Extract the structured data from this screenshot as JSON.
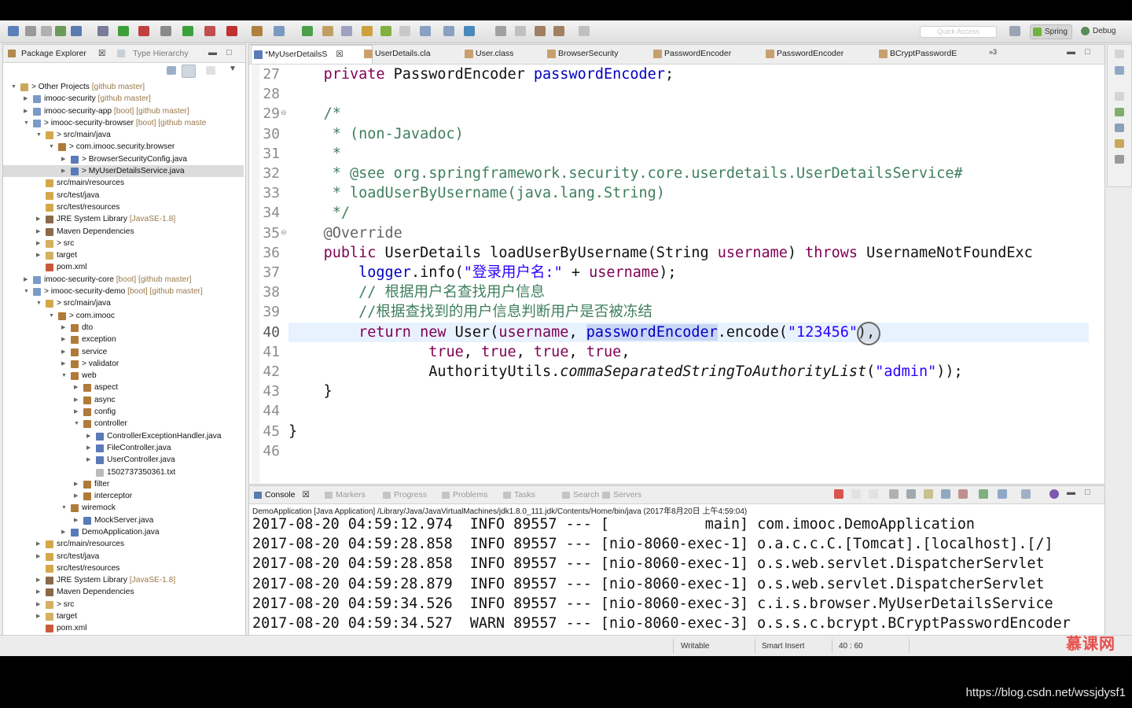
{
  "toolbar": {
    "quick_access_placeholder": "Quick Access",
    "perspectives": [
      {
        "label": "Spring",
        "active": true
      },
      {
        "label": "Debug",
        "active": false
      }
    ]
  },
  "explorer": {
    "tabs": [
      {
        "label": "Package Explorer",
        "active": true
      },
      {
        "label": "Type Hierarchy",
        "active": false
      }
    ],
    "tree": [
      {
        "label": "> Other Projects",
        "decor": "[github master]",
        "indent": 0,
        "arrow": "▼",
        "icon": "project-folder",
        "selected": false
      },
      {
        "label": "imooc-security",
        "decor": "[github master]",
        "indent": 1,
        "arrow": "▶",
        "icon": "project",
        "selected": false
      },
      {
        "label": "imooc-security-app",
        "decor": "[boot] [github master]",
        "indent": 1,
        "arrow": "▶",
        "icon": "project",
        "selected": false
      },
      {
        "label": "> imooc-security-browser",
        "decor": "[boot] [github maste",
        "indent": 1,
        "arrow": "▼",
        "icon": "project",
        "selected": false
      },
      {
        "label": "> src/main/java",
        "decor": "",
        "indent": 2,
        "arrow": "▼",
        "icon": "source-folder",
        "selected": false
      },
      {
        "label": "> com.imooc.security.browser",
        "decor": "",
        "indent": 3,
        "arrow": "▼",
        "icon": "package",
        "selected": false
      },
      {
        "label": "> BrowserSecurityConfig.java",
        "decor": "",
        "indent": 4,
        "arrow": "▶",
        "icon": "java-file",
        "selected": false
      },
      {
        "label": "> MyUserDetailsService.java",
        "decor": "",
        "indent": 4,
        "arrow": "▶",
        "icon": "java-file",
        "selected": true
      },
      {
        "label": "src/main/resources",
        "decor": "",
        "indent": 2,
        "arrow": "",
        "icon": "source-folder",
        "selected": false
      },
      {
        "label": "src/test/java",
        "decor": "",
        "indent": 2,
        "arrow": "",
        "icon": "source-folder",
        "selected": false
      },
      {
        "label": "src/test/resources",
        "decor": "",
        "indent": 2,
        "arrow": "",
        "icon": "source-folder",
        "selected": false
      },
      {
        "label": "JRE System Library",
        "decor": "[JavaSE-1.8]",
        "indent": 2,
        "arrow": "▶",
        "icon": "library",
        "selected": false
      },
      {
        "label": "Maven Dependencies",
        "decor": "",
        "indent": 2,
        "arrow": "▶",
        "icon": "library",
        "selected": false
      },
      {
        "label": "> src",
        "decor": "",
        "indent": 2,
        "arrow": "▶",
        "icon": "folder",
        "selected": false
      },
      {
        "label": "target",
        "decor": "",
        "indent": 2,
        "arrow": "▶",
        "icon": "folder",
        "selected": false
      },
      {
        "label": "pom.xml",
        "decor": "",
        "indent": 2,
        "arrow": "",
        "icon": "xml-file",
        "selected": false
      },
      {
        "label": "imooc-security-core",
        "decor": "[boot] [github master]",
        "indent": 1,
        "arrow": "▶",
        "icon": "project",
        "selected": false
      },
      {
        "label": "> imooc-security-demo",
        "decor": "[boot] [github master]",
        "indent": 1,
        "arrow": "▼",
        "icon": "project",
        "selected": false
      },
      {
        "label": "> src/main/java",
        "decor": "",
        "indent": 2,
        "arrow": "▼",
        "icon": "source-folder",
        "selected": false
      },
      {
        "label": "> com.imooc",
        "decor": "",
        "indent": 3,
        "arrow": "▼",
        "icon": "package",
        "selected": false
      },
      {
        "label": "dto",
        "decor": "",
        "indent": 4,
        "arrow": "▶",
        "icon": "package",
        "selected": false
      },
      {
        "label": "exception",
        "decor": "",
        "indent": 4,
        "arrow": "▶",
        "icon": "package",
        "selected": false
      },
      {
        "label": "service",
        "decor": "",
        "indent": 4,
        "arrow": "▶",
        "icon": "package",
        "selected": false
      },
      {
        "label": "> validator",
        "decor": "",
        "indent": 4,
        "arrow": "▶",
        "icon": "package",
        "selected": false
      },
      {
        "label": "web",
        "decor": "",
        "indent": 4,
        "arrow": "▼",
        "icon": "package",
        "selected": false
      },
      {
        "label": "aspect",
        "decor": "",
        "indent": 5,
        "arrow": "▶",
        "icon": "package",
        "selected": false
      },
      {
        "label": "async",
        "decor": "",
        "indent": 5,
        "arrow": "▶",
        "icon": "package",
        "selected": false
      },
      {
        "label": "config",
        "decor": "",
        "indent": 5,
        "arrow": "▶",
        "icon": "package",
        "selected": false
      },
      {
        "label": "controller",
        "decor": "",
        "indent": 5,
        "arrow": "▼",
        "icon": "package",
        "selected": false
      },
      {
        "label": "ControllerExceptionHandler.java",
        "decor": "",
        "indent": 6,
        "arrow": "▶",
        "icon": "java-file",
        "selected": false
      },
      {
        "label": "FileController.java",
        "decor": "",
        "indent": 6,
        "arrow": "▶",
        "icon": "java-file",
        "selected": false
      },
      {
        "label": "UserController.java",
        "decor": "",
        "indent": 6,
        "arrow": "▶",
        "icon": "java-file",
        "selected": false
      },
      {
        "label": "1502737350361.txt",
        "decor": "",
        "indent": 6,
        "arrow": "",
        "icon": "text-file",
        "selected": false
      },
      {
        "label": "filter",
        "decor": "",
        "indent": 5,
        "arrow": "▶",
        "icon": "package",
        "selected": false
      },
      {
        "label": "interceptor",
        "decor": "",
        "indent": 5,
        "arrow": "▶",
        "icon": "package",
        "selected": false
      },
      {
        "label": "wiremock",
        "decor": "",
        "indent": 4,
        "arrow": "▼",
        "icon": "package",
        "selected": false
      },
      {
        "label": "MockServer.java",
        "decor": "",
        "indent": 5,
        "arrow": "▶",
        "icon": "java-file",
        "selected": false
      },
      {
        "label": "DemoApplication.java",
        "decor": "",
        "indent": 4,
        "arrow": "▶",
        "icon": "java-file",
        "selected": false
      },
      {
        "label": "src/main/resources",
        "decor": "",
        "indent": 2,
        "arrow": "▶",
        "icon": "source-folder",
        "selected": false
      },
      {
        "label": "src/test/java",
        "decor": "",
        "indent": 2,
        "arrow": "▶",
        "icon": "source-folder",
        "selected": false
      },
      {
        "label": "src/test/resources",
        "decor": "",
        "indent": 2,
        "arrow": "",
        "icon": "source-folder",
        "selected": false
      },
      {
        "label": "JRE System Library",
        "decor": "[JavaSE-1.8]",
        "indent": 2,
        "arrow": "▶",
        "icon": "library",
        "selected": false
      },
      {
        "label": "Maven Dependencies",
        "decor": "",
        "indent": 2,
        "arrow": "▶",
        "icon": "library",
        "selected": false
      },
      {
        "label": "> src",
        "decor": "",
        "indent": 2,
        "arrow": "▶",
        "icon": "folder",
        "selected": false
      },
      {
        "label": "target",
        "decor": "",
        "indent": 2,
        "arrow": "▶",
        "icon": "folder",
        "selected": false
      },
      {
        "label": "pom.xml",
        "decor": "",
        "indent": 2,
        "arrow": "",
        "icon": "xml-file",
        "selected": false
      }
    ]
  },
  "editor": {
    "tabs": [
      {
        "label": "*MyUserDetailsS",
        "active": true,
        "closable": true
      },
      {
        "label": "UserDetails.cla",
        "active": false
      },
      {
        "label": "User.class",
        "active": false
      },
      {
        "label": "BrowserSecurity",
        "active": false
      },
      {
        "label": "PasswordEncoder",
        "active": false
      },
      {
        "label": "PasswordEncoder",
        "active": false
      },
      {
        "label": "BCryptPasswordE",
        "active": false
      }
    ],
    "overflow_label": "»3",
    "current_line": 40,
    "lines": [
      {
        "n": 27,
        "fold": "",
        "segs": [
          [
            "    ",
            ""
          ],
          [
            "private",
            "kw"
          ],
          [
            " PasswordEncoder ",
            ""
          ],
          [
            "passwordEncoder",
            "fld"
          ],
          [
            ";",
            ""
          ]
        ]
      },
      {
        "n": 28,
        "fold": "",
        "segs": []
      },
      {
        "n": 29,
        "fold": "⊖",
        "segs": [
          [
            "    ",
            ""
          ],
          [
            "/*",
            "cmt"
          ]
        ]
      },
      {
        "n": 30,
        "fold": "",
        "segs": [
          [
            "     * (non-Javadoc)",
            "cmt"
          ]
        ]
      },
      {
        "n": 31,
        "fold": "",
        "segs": [
          [
            "     *",
            "cmt"
          ]
        ]
      },
      {
        "n": 32,
        "fold": "",
        "segs": [
          [
            "     * @see org.springframework.security.core.userdetails.UserDetailsService#",
            "cmt"
          ]
        ]
      },
      {
        "n": 33,
        "fold": "",
        "segs": [
          [
            "     * loadUserByUsername(java.lang.String)",
            "cmt"
          ]
        ]
      },
      {
        "n": 34,
        "fold": "",
        "segs": [
          [
            "     */",
            "cmt"
          ]
        ]
      },
      {
        "n": 35,
        "fold": "⊖",
        "segs": [
          [
            "    ",
            ""
          ],
          [
            "@Override",
            "ann"
          ]
        ]
      },
      {
        "n": 36,
        "fold": "",
        "segs": [
          [
            "    ",
            ""
          ],
          [
            "public",
            "kw"
          ],
          [
            " UserDetails loadUserByUsername(String ",
            ""
          ],
          [
            "username",
            "kw-var"
          ],
          [
            ") ",
            ""
          ],
          [
            "throws",
            "kw"
          ],
          [
            " UsernameNotFoundExc",
            ""
          ]
        ]
      },
      {
        "n": 37,
        "fold": "",
        "segs": [
          [
            "        ",
            ""
          ],
          [
            "logger",
            "fld"
          ],
          [
            ".info(",
            ""
          ],
          [
            "\"登录用户名:\"",
            "str"
          ],
          [
            " + ",
            ""
          ],
          [
            "username",
            "kw-var"
          ],
          [
            ");",
            ""
          ]
        ]
      },
      {
        "n": 38,
        "fold": "",
        "segs": [
          [
            "        ",
            ""
          ],
          [
            "// 根据用户名查找用户信息",
            "cmt"
          ]
        ]
      },
      {
        "n": 39,
        "fold": "",
        "segs": [
          [
            "        ",
            ""
          ],
          [
            "//根据查找到的用户信息判断用户是否被冻结",
            "cmt"
          ]
        ]
      },
      {
        "n": 40,
        "fold": "",
        "segs": [
          [
            "        ",
            ""
          ],
          [
            "return",
            "kw"
          ],
          [
            " ",
            ""
          ],
          [
            "new",
            "kw"
          ],
          [
            " User(",
            ""
          ],
          [
            "username",
            "kw-var"
          ],
          [
            ", ",
            ""
          ],
          [
            "passwordEncoder",
            "fld hl"
          ],
          [
            ".encode(",
            ""
          ],
          [
            "\"123456\"",
            "str"
          ],
          [
            "),",
            ""
          ]
        ]
      },
      {
        "n": 41,
        "fold": "",
        "segs": [
          [
            "                ",
            ""
          ],
          [
            "true",
            "kw"
          ],
          [
            ", ",
            ""
          ],
          [
            "true",
            "kw"
          ],
          [
            ", ",
            ""
          ],
          [
            "true",
            "kw"
          ],
          [
            ", ",
            ""
          ],
          [
            "true",
            "kw"
          ],
          [
            ",",
            ""
          ]
        ]
      },
      {
        "n": 42,
        "fold": "",
        "segs": [
          [
            "                AuthorityUtils.",
            ""
          ],
          [
            "commaSeparatedStringToAuthorityList",
            "ital"
          ],
          [
            "(",
            ""
          ],
          [
            "\"admin\"",
            "str"
          ],
          [
            "));",
            ""
          ]
        ]
      },
      {
        "n": 43,
        "fold": "",
        "segs": [
          [
            "    }",
            ""
          ]
        ]
      },
      {
        "n": 44,
        "fold": "",
        "segs": []
      },
      {
        "n": 45,
        "fold": "",
        "segs": [
          [
            "}",
            ""
          ]
        ]
      },
      {
        "n": 46,
        "fold": "",
        "segs": []
      }
    ]
  },
  "console": {
    "tabs": [
      {
        "label": "Console",
        "active": true
      },
      {
        "label": "Markers",
        "active": false
      },
      {
        "label": "Progress",
        "active": false
      },
      {
        "label": "Problems",
        "active": false
      },
      {
        "label": "Tasks",
        "active": false
      },
      {
        "label": "Search",
        "active": false
      },
      {
        "label": "Servers",
        "active": false
      }
    ],
    "description": "DemoApplication [Java Application] /Library/Java/JavaVirtualMachines/jdk1.8.0_111.jdk/Contents/Home/bin/java (2017年8月20日 上午4:59:04)",
    "lines": [
      "2017-08-20 04:59:12.974  INFO 89557 --- [           main] com.imooc.DemoApplication",
      "2017-08-20 04:59:28.858  INFO 89557 --- [nio-8060-exec-1] o.a.c.c.C.[Tomcat].[localhost].[/]",
      "2017-08-20 04:59:28.858  INFO 89557 --- [nio-8060-exec-1] o.s.web.servlet.DispatcherServlet",
      "2017-08-20 04:59:28.879  INFO 89557 --- [nio-8060-exec-1] o.s.web.servlet.DispatcherServlet",
      "2017-08-20 04:59:34.526  INFO 89557 --- [nio-8060-exec-3] c.i.s.browser.MyUserDetailsService",
      "2017-08-20 04:59:34.527  WARN 89557 --- [nio-8060-exec-3] o.s.s.c.bcrypt.BCryptPasswordEncoder"
    ]
  },
  "status": {
    "writable": "Writable",
    "insert_mode": "Smart Insert",
    "position": "40 : 60"
  },
  "watermark": "慕课网",
  "url_overlay": "https://blog.csdn.net/wssjdysf1"
}
